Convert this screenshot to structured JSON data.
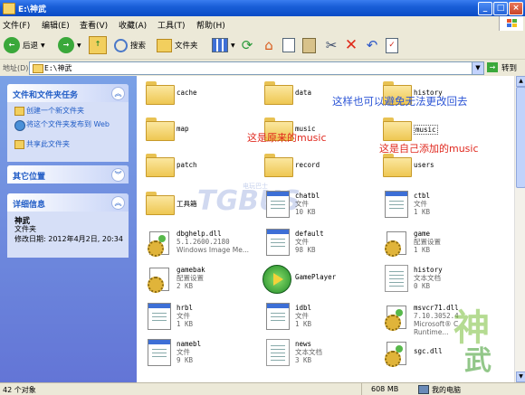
{
  "window": {
    "title": "E:\\神武"
  },
  "menu": [
    "文件(F)",
    "编辑(E)",
    "查看(V)",
    "收藏(A)",
    "工具(T)",
    "帮助(H)"
  ],
  "toolbar": {
    "back": "后退",
    "search": "搜索",
    "folders": "文件夹"
  },
  "address": {
    "label": "地址(D)",
    "value": "E:\\神武",
    "go": "转到"
  },
  "sidebar": {
    "tasks_title": "文件和文件夹任务",
    "tasks": [
      "创建一个新文件夹",
      "将这个文件夹发布到 Web",
      "共享此文件夹"
    ],
    "other_title": "其它位置",
    "details_title": "详细信息",
    "details_name": "神武",
    "details_type": "文件夹",
    "details_modified": "修改日期: 2012年4月2日, 20:34"
  },
  "items": [
    {
      "name": "cache",
      "kind": "folder"
    },
    {
      "name": "data",
      "kind": "folder"
    },
    {
      "name": "history",
      "kind": "folder"
    },
    {
      "name": "map",
      "kind": "folder"
    },
    {
      "name": "music",
      "kind": "folder"
    },
    {
      "name": "music",
      "kind": "folder"
    },
    {
      "name": "patch",
      "kind": "folder"
    },
    {
      "name": "record",
      "kind": "folder"
    },
    {
      "name": "users",
      "kind": "folder"
    },
    {
      "name": "工具箱",
      "kind": "folder"
    },
    {
      "name": "chatbl",
      "type": "文件",
      "size": "10 KB",
      "kind": "doc"
    },
    {
      "name": "ctbl",
      "type": "文件",
      "size": "1 KB",
      "kind": "doc"
    },
    {
      "name": "dbghelp.dll",
      "type": "5.1.2600.2180",
      "size": "Windows Image Me...",
      "kind": "gear"
    },
    {
      "name": "default",
      "type": "文件",
      "size": "98 KB",
      "kind": "doc"
    },
    {
      "name": "game",
      "type": "配置设置",
      "size": "1 KB",
      "kind": "gear"
    },
    {
      "name": "gamebak",
      "type": "配置设置",
      "size": "2 KB",
      "kind": "gear"
    },
    {
      "name": "GamePlayer",
      "type": "",
      "size": "",
      "kind": "player"
    },
    {
      "name": "history",
      "type": "文本文档",
      "size": "0 KB",
      "kind": "text"
    },
    {
      "name": "hrbl",
      "type": "文件",
      "size": "1 KB",
      "kind": "doc"
    },
    {
      "name": "idbl",
      "type": "文件",
      "size": "1 KB",
      "kind": "doc"
    },
    {
      "name": "msvcr71.dll",
      "type": "7.10.3052.4",
      "size": "Microsoft® C Runtime...",
      "kind": "gear"
    },
    {
      "name": "namebl",
      "type": "文件",
      "size": "9 KB",
      "kind": "doc"
    },
    {
      "name": "news",
      "type": "文本文档",
      "size": "3 KB",
      "kind": "text"
    },
    {
      "name": "sgc.dll",
      "type": "",
      "size": "",
      "kind": "gear"
    }
  ],
  "annotations": {
    "top": "这样也可以避免无法更改回去",
    "original": "这是原来的music",
    "added": "这是自己添加的music"
  },
  "watermark": {
    "logo": "TGBUS",
    "small": "电玩巴士"
  },
  "status": {
    "count": "42 个对象",
    "size": "608 MB",
    "location": "我的电脑"
  }
}
